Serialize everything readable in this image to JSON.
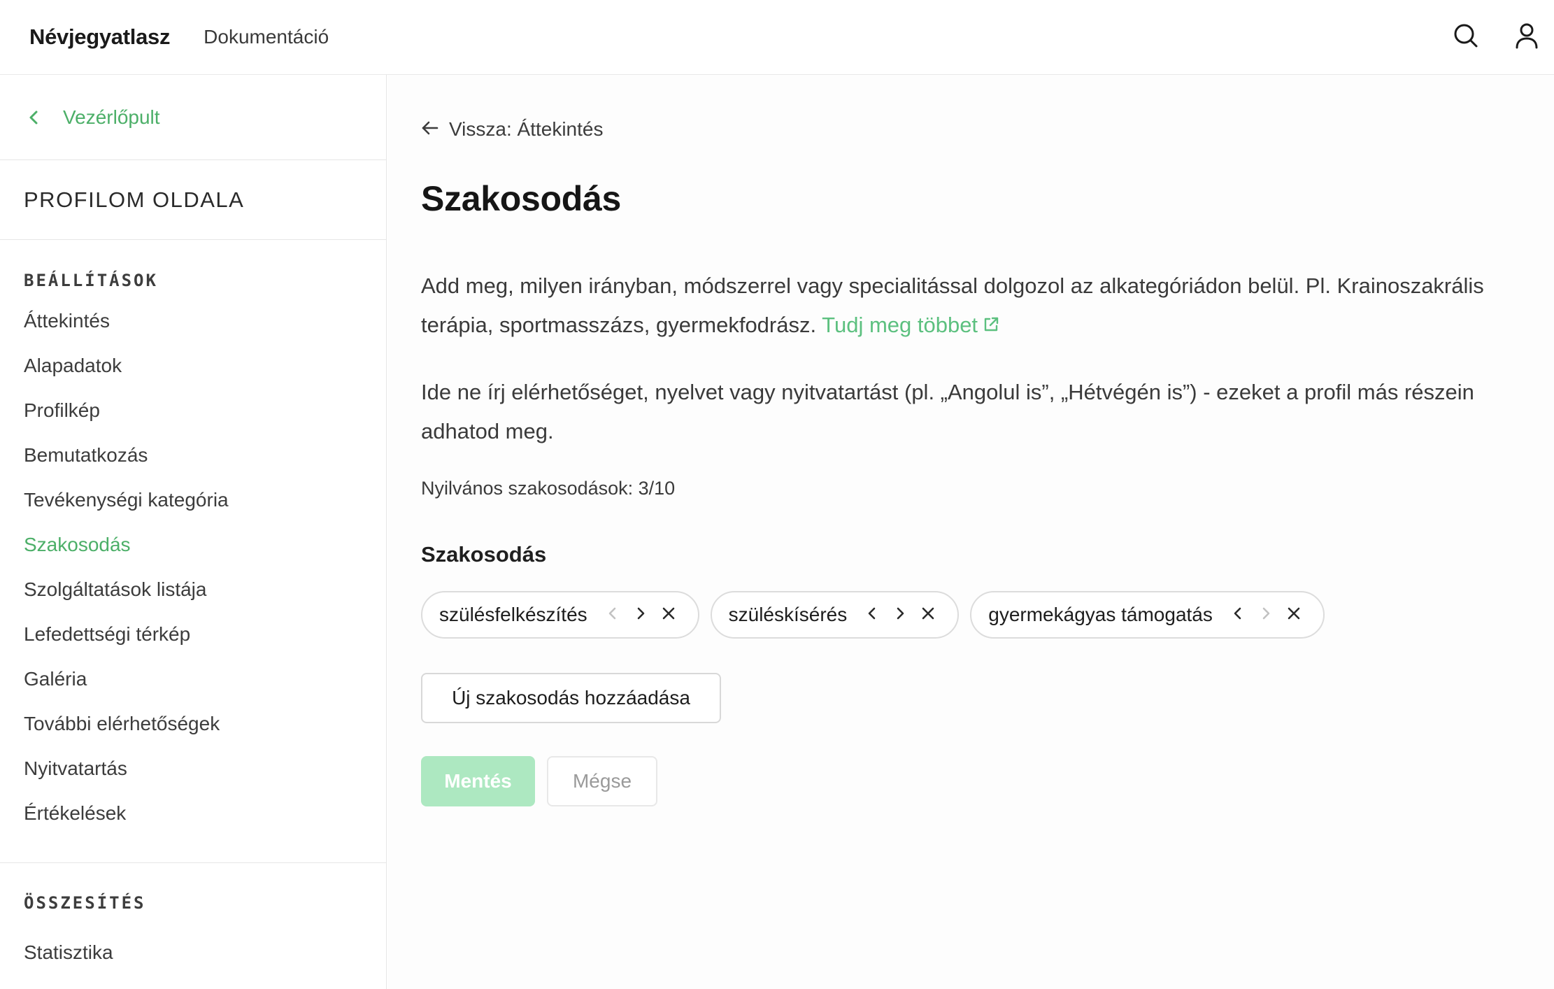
{
  "header": {
    "brand": "Névjegyatlasz",
    "nav_doc": "Dokumentáció",
    "search_icon": "search-icon",
    "user_icon": "user-icon"
  },
  "sidebar": {
    "back_label": "Vezérlőpult",
    "profile_title": "PROFILOM OLDALA",
    "settings_heading": "BEÁLLÍTÁSOK",
    "items": [
      {
        "label": "Áttekintés",
        "active": false
      },
      {
        "label": "Alapadatok",
        "active": false
      },
      {
        "label": "Profilkép",
        "active": false
      },
      {
        "label": "Bemutatkozás",
        "active": false
      },
      {
        "label": "Tevékenységi kategória",
        "active": false
      },
      {
        "label": "Szakosodás",
        "active": true
      },
      {
        "label": "Szolgáltatások listája",
        "active": false
      },
      {
        "label": "Lefedettségi térkép",
        "active": false
      },
      {
        "label": "Galéria",
        "active": false
      },
      {
        "label": "További elérhetőségek",
        "active": false
      },
      {
        "label": "Nyitvatartás",
        "active": false
      },
      {
        "label": "Értékelések",
        "active": false
      }
    ],
    "summary_heading": "ÖSSZESÍTÉS",
    "summary_items": [
      {
        "label": "Statisztika"
      }
    ]
  },
  "main": {
    "back_label": "Vissza: Áttekintés",
    "title": "Szakosodás",
    "para1": "Add meg, milyen irányban, módszerrel vagy specialitással dolgozol az alkategóriádon belül. Pl. Krainoszakrális terápia, sportmasszázs, gyermekfodrász.",
    "para1_link": "Tudj meg többet",
    "para2": "Ide ne írj elérhetőséget, nyelvet vagy nyitvatartást (pl. „Angolul is”, „Hétvégén is”) - ezeket a profil más részein adhatod meg.",
    "public_count": "Nyilvános szakosodások: 3/10",
    "field_label": "Szakosodás",
    "chips": [
      {
        "label": "szülésfelkészítés",
        "prev_enabled": false,
        "next_enabled": true
      },
      {
        "label": "szüléskísérés",
        "prev_enabled": true,
        "next_enabled": true
      },
      {
        "label": "gyermekágyas támogatás",
        "prev_enabled": true,
        "next_enabled": false
      }
    ],
    "add_button": "Új szakosodás hozzáadása",
    "save_button": "Mentés",
    "cancel_button": "Mégse"
  },
  "colors": {
    "accent": "#4caf68",
    "link": "#5cc07f",
    "save_disabled": "#ade8c1"
  }
}
